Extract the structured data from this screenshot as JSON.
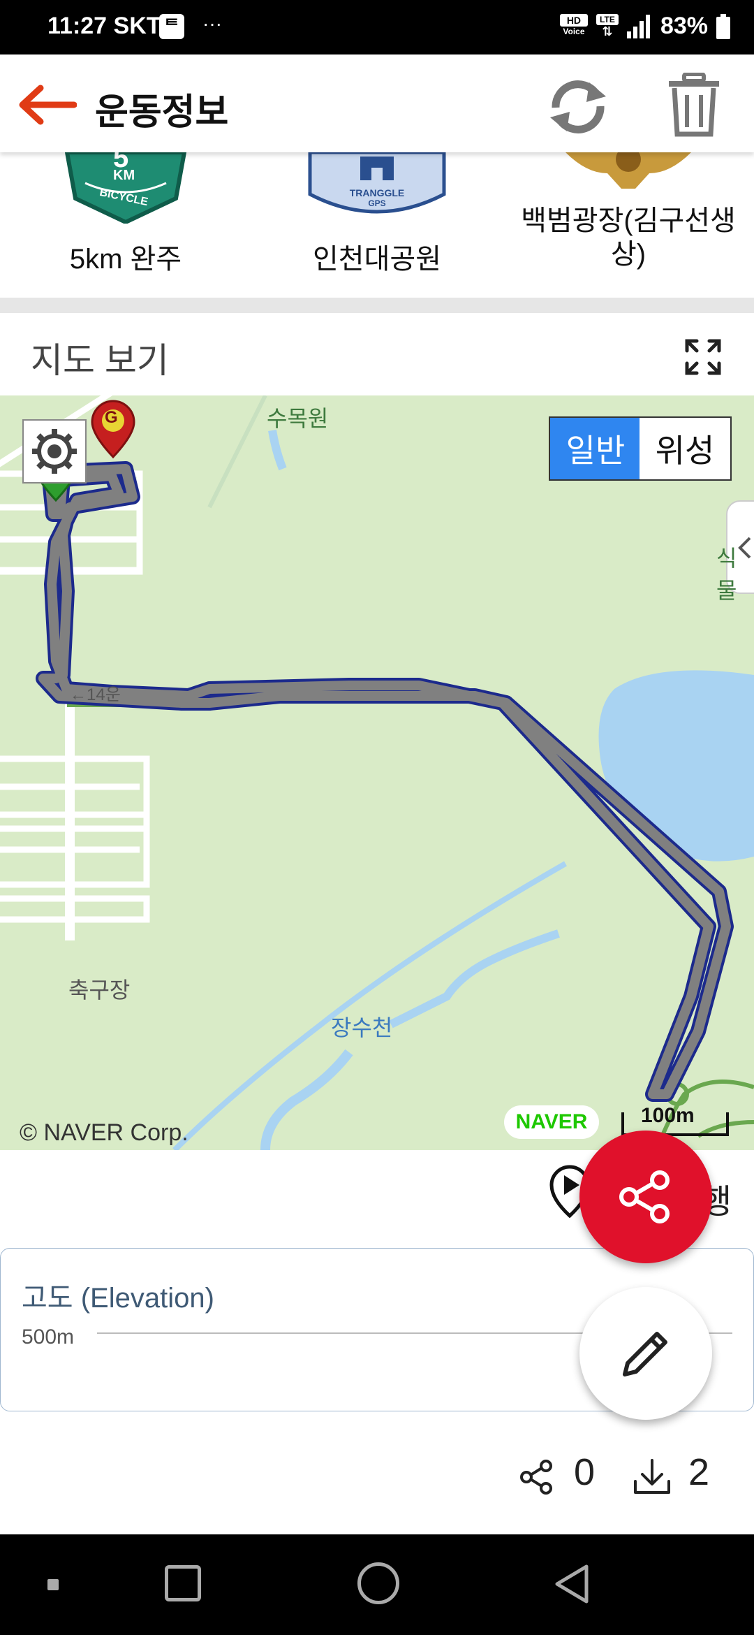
{
  "status_bar": {
    "time": "11:27",
    "carrier": "SKT",
    "carrier_icon": "talk-icon",
    "overflow": "···",
    "hd_voice": "HD\nVoice",
    "lte": "LTE",
    "battery": "83%"
  },
  "header": {
    "title": "운동정보",
    "back_icon": "back-arrow-icon",
    "sync_icon": "refresh-icon",
    "delete_icon": "trash-icon"
  },
  "badges": [
    {
      "label": "5km 완주",
      "badge_text_top": "5",
      "badge_text_km": "KM",
      "badge_text_bottom": "BICYCLE"
    },
    {
      "label": "인천대공원",
      "badge_text": "TRANGGLE",
      "badge_text_sub": "GPS"
    },
    {
      "label": "백범광장(김구선생상)"
    }
  ],
  "map_section": {
    "title": "지도 보기",
    "fullscreen_icon": "fullscreen-icon"
  },
  "map": {
    "toggle_normal": "일반",
    "toggle_satellite": "위성",
    "labels": {
      "sumokwon": "수목원",
      "botanical": "식물",
      "janggu": "축구장",
      "jangsucheon": "장수천",
      "road": "←14운"
    },
    "copyright": "© NAVER Corp.",
    "naver_logo": "NAVER",
    "scale": "100m",
    "start_marker": "S",
    "goal_marker": "G"
  },
  "replay": {
    "label": "행",
    "icon": "play-location-icon"
  },
  "elevation": {
    "title": "고도 (Elevation)",
    "y_label": "500m"
  },
  "stats": {
    "shares": "0",
    "downloads": "2"
  },
  "colors": {
    "accent_red": "#e0112b",
    "back_arrow": "#e03b15",
    "map_bg": "#d9ebc7",
    "route": "#808080",
    "route_border": "#1c2a8c",
    "toggle_active": "#2f86f0"
  }
}
